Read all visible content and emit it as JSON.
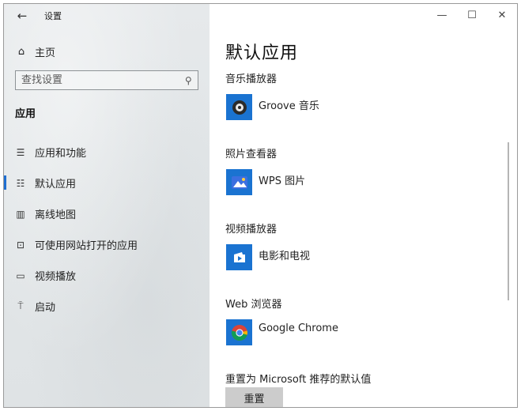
{
  "window": {
    "title": "设置",
    "back_icon": "back-arrow-icon"
  },
  "sidebar": {
    "home": {
      "icon": "home-icon",
      "label": "主页"
    },
    "search": {
      "placeholder": "查找设置",
      "icon": "search-icon"
    },
    "section_title": "应用",
    "items": [
      {
        "icon": "apps-features-icon",
        "label": "应用和功能",
        "active": false
      },
      {
        "icon": "default-apps-icon",
        "label": "默认应用",
        "active": true
      },
      {
        "icon": "offline-maps-icon",
        "label": "离线地图",
        "active": false
      },
      {
        "icon": "apps-for-websites-icon",
        "label": "可使用网站打开的应用",
        "active": false
      },
      {
        "icon": "video-playback-icon",
        "label": "视频播放",
        "active": false
      },
      {
        "icon": "startup-icon",
        "label": "启动",
        "active": false
      }
    ]
  },
  "controls": {
    "minimize": "—",
    "maximize": "☐",
    "close": "✕"
  },
  "main": {
    "title": "默认应用",
    "groups": [
      {
        "label": "音乐播放器",
        "app": "Groove 音乐",
        "icon": "groove-music-icon"
      },
      {
        "label": "照片查看器",
        "app": "WPS 图片",
        "icon": "wps-picture-icon"
      },
      {
        "label": "视频播放器",
        "app": "电影和电视",
        "icon": "movies-tv-icon"
      },
      {
        "label": "Web 浏览器",
        "app": "Google Chrome",
        "icon": "google-chrome-icon"
      }
    ],
    "reset_label": "重置为 Microsoft 推荐的默认值",
    "reset_button": "重置"
  },
  "colors": {
    "accent": "#1f6fd1",
    "tile": "#1a73d1",
    "sidebar_bg": "#e2e6e8",
    "button_bg": "#cccccc"
  }
}
